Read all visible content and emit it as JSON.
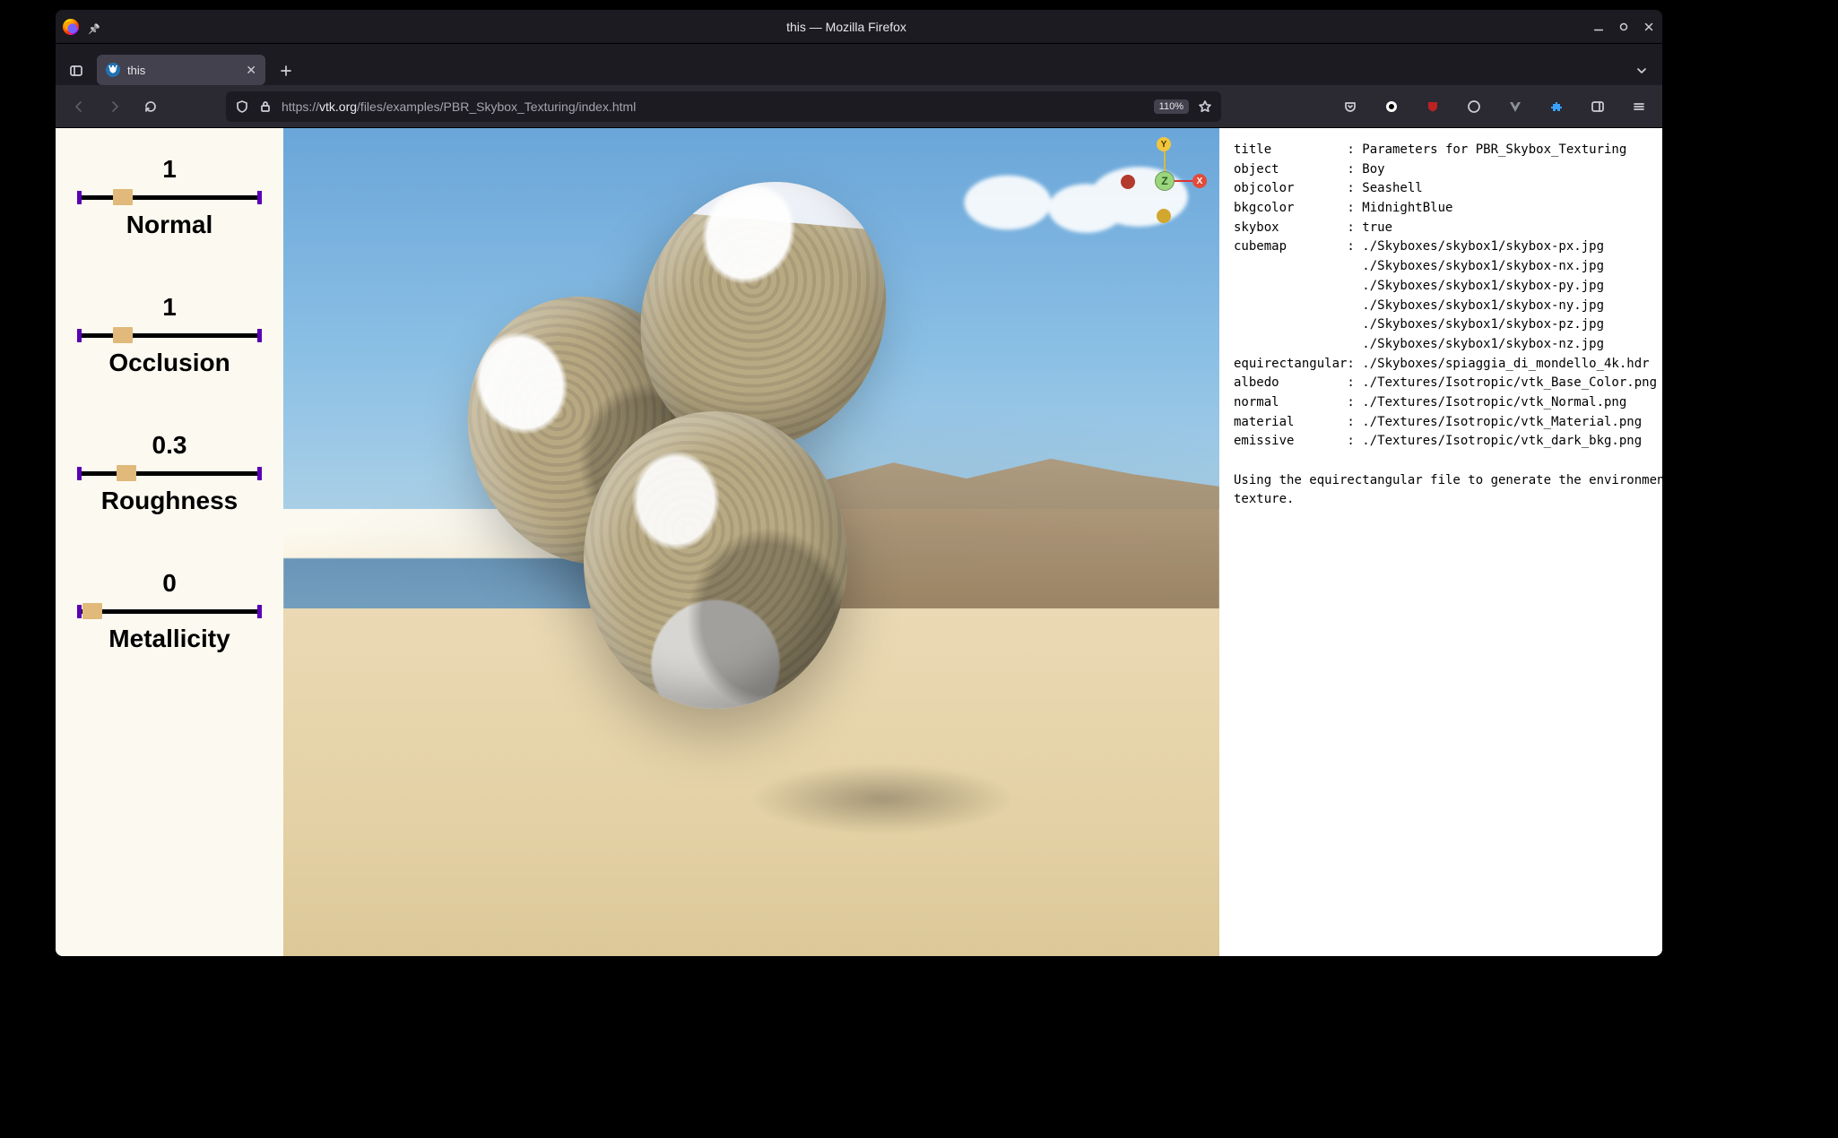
{
  "window": {
    "title": "this — Mozilla Firefox"
  },
  "tab": {
    "title": "this"
  },
  "toolbar": {
    "url_prefix": "https://",
    "url_host": "vtk.org",
    "url_path": "/files/examples/PBR_Skybox_Texturing/index.html",
    "zoom": "110%"
  },
  "sliders": [
    {
      "value": "1",
      "label": "Normal",
      "pos": 0.22
    },
    {
      "value": "1",
      "label": "Occlusion",
      "pos": 0.22
    },
    {
      "value": "0.3",
      "label": "Roughness",
      "pos": 0.24
    },
    {
      "value": "0",
      "label": "Metallicity",
      "pos": 0.03
    }
  ],
  "gizmo": {
    "center": "Z",
    "x": "X",
    "y": "Y"
  },
  "params_text": "title          : Parameters for PBR_Skybox_Texturing\nobject         : Boy\nobjcolor       : Seashell\nbkgcolor       : MidnightBlue\nskybox         : true\ncubemap        : ./Skyboxes/skybox1/skybox-px.jpg\n                 ./Skyboxes/skybox1/skybox-nx.jpg\n                 ./Skyboxes/skybox1/skybox-py.jpg\n                 ./Skyboxes/skybox1/skybox-ny.jpg\n                 ./Skyboxes/skybox1/skybox-pz.jpg\n                 ./Skyboxes/skybox1/skybox-nz.jpg\nequirectangular: ./Skyboxes/spiaggia_di_mondello_4k.hdr\nalbedo         : ./Textures/Isotropic/vtk_Base_Color.png\nnormal         : ./Textures/Isotropic/vtk_Normal.png\nmaterial       : ./Textures/Isotropic/vtk_Material.png\nemissive       : ./Textures/Isotropic/vtk_dark_bkg.png\n\nUsing the equirectangular file to generate the environment\ntexture."
}
